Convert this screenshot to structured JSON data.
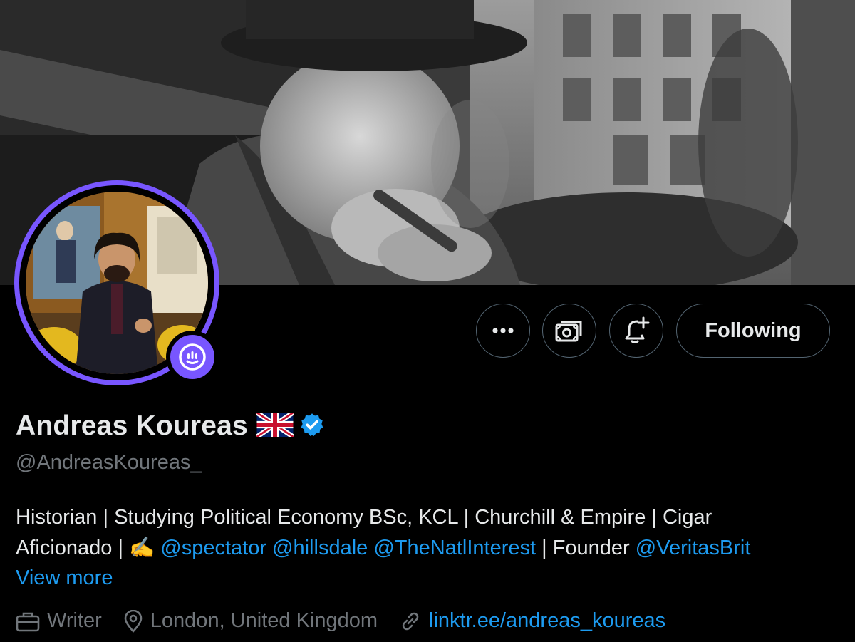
{
  "profile": {
    "display_name": "Andreas Koureas",
    "handle": "@AndreasKoureas_",
    "flag_icon": "uk-flag-icon",
    "verified_icon": "verified-badge-icon",
    "bio": {
      "line1": "Historian | Studying Political Economy BSc, KCL | Churchill & Empire | Cigar",
      "line2_prefix": "Aficionado | ",
      "writing_emoji": "✍️",
      "mentions": [
        "@spectator",
        "@hillsdale",
        "@TheNatlInterest"
      ],
      "founder_text": "| Founder",
      "founder_mention": "@VeritasBrit"
    },
    "view_more": "View more",
    "meta": {
      "profession": "Writer",
      "location": "London, United Kingdom",
      "link": "linktr.ee/andreas_koureas"
    }
  },
  "actions": {
    "more_icon": "more-dots-icon",
    "tip_icon": "money-tip-icon",
    "notify_icon": "bell-plus-icon",
    "follow_label": "Following"
  },
  "colors": {
    "accent_purple": "#7856ff",
    "link_blue": "#1d9bf0",
    "muted_gray": "#71767b",
    "border_gray": "#536471"
  }
}
